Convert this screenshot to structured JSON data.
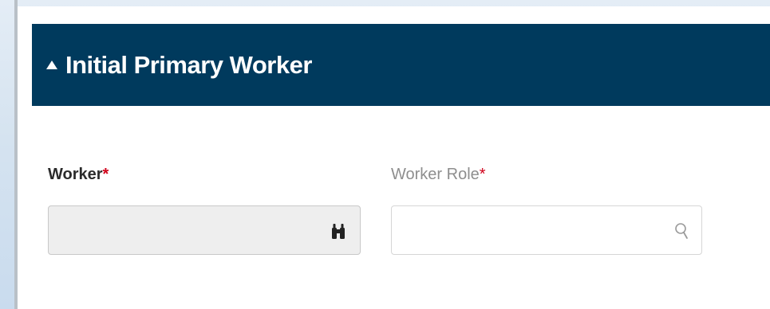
{
  "section": {
    "title": "Initial Primary Worker",
    "caret_icon": "caret-up-icon"
  },
  "fields": {
    "worker": {
      "label": "Worker",
      "required_marker": "*",
      "value": "",
      "icon": "binoculars-icon",
      "disabled": true
    },
    "worker_role": {
      "label": "Worker Role",
      "required_marker": "*",
      "value": "",
      "icon": "search-icon",
      "disabled": false
    }
  },
  "colors": {
    "header_bg": "#003a5d",
    "required": "#d0021b",
    "disabled_field_bg": "#eeeeee"
  }
}
